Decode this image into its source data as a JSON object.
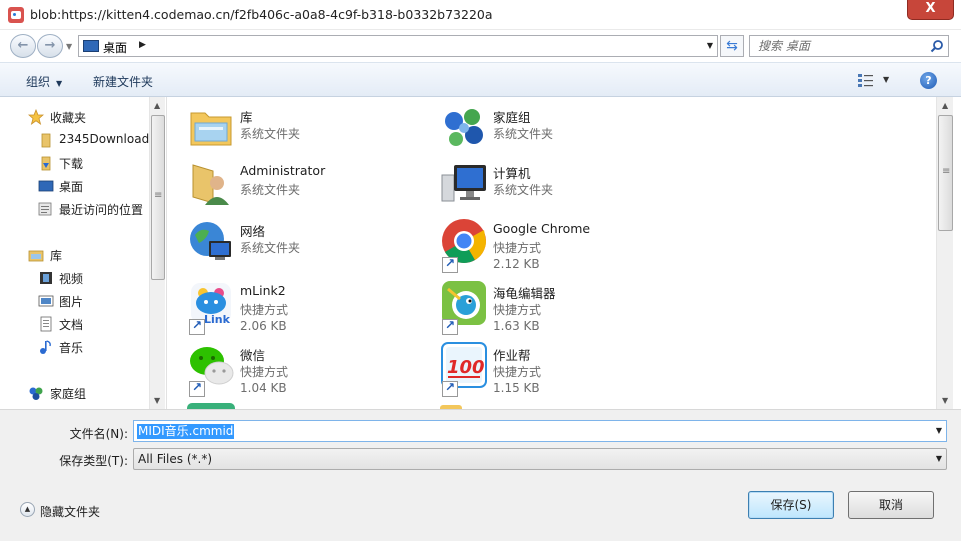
{
  "window": {
    "title": "blob:https://kitten4.codemao.cn/f2fb406c-a0a8-4c9f-b318-b0332b73220a",
    "close_glyph": "X"
  },
  "nav": {
    "breadcrumb": "桌面",
    "search_placeholder": "搜索 桌面"
  },
  "toolbar": {
    "organize": "组织",
    "new_folder": "新建文件夹"
  },
  "sidebar": {
    "items": [
      {
        "label": "收藏夹",
        "icon": "star-icon"
      },
      {
        "label": "2345Downloads",
        "icon": "folder-icon"
      },
      {
        "label": "下载",
        "icon": "download-folder-icon"
      },
      {
        "label": "桌面",
        "icon": "desktop-icon"
      },
      {
        "label": "最近访问的位置",
        "icon": "recent-places-icon"
      },
      {
        "label": "库",
        "icon": "library-icon"
      },
      {
        "label": "视频",
        "icon": "video-icon"
      },
      {
        "label": "图片",
        "icon": "pictures-icon"
      },
      {
        "label": "文档",
        "icon": "documents-icon"
      },
      {
        "label": "音乐",
        "icon": "music-icon"
      },
      {
        "label": "家庭组",
        "icon": "homegroup-icon"
      }
    ]
  },
  "files": [
    {
      "name": "库",
      "type": "系统文件夹",
      "size": "",
      "icon": "library-folder-icon"
    },
    {
      "name": "家庭组",
      "type": "系统文件夹",
      "size": "",
      "icon": "homegroup-icon"
    },
    {
      "name": "Administrator",
      "type": "系统文件夹",
      "size": "",
      "icon": "user-folder-icon"
    },
    {
      "name": "计算机",
      "type": "系统文件夹",
      "size": "",
      "icon": "computer-icon"
    },
    {
      "name": "网络",
      "type": "系统文件夹",
      "size": "",
      "icon": "network-icon"
    },
    {
      "name": "Google Chrome",
      "type": "快捷方式",
      "size": "2.12 KB",
      "icon": "chrome-icon"
    },
    {
      "name": "mLink2",
      "type": "快捷方式",
      "size": "2.06 KB",
      "icon": "mlink-icon"
    },
    {
      "name": "海龟编辑器",
      "type": "快捷方式",
      "size": "1.63 KB",
      "icon": "turtle-editor-icon"
    },
    {
      "name": "微信",
      "type": "快捷方式",
      "size": "1.04 KB",
      "icon": "wechat-icon"
    },
    {
      "name": "作业帮",
      "type": "快捷方式",
      "size": "1.15 KB",
      "icon": "zuoyebang-icon"
    }
  ],
  "form": {
    "filename_label": "文件名(N):",
    "filename_value": "MIDI音乐.cmmid",
    "filetype_label": "保存类型(T):",
    "filetype_value": "All Files (*.*)",
    "hide_folders": "隐藏文件夹",
    "save": "保存(S)",
    "cancel": "取消"
  },
  "colors": {
    "selection": "#3399ff",
    "close_button": "#c7463a",
    "toolbar_text": "#1e395b"
  }
}
